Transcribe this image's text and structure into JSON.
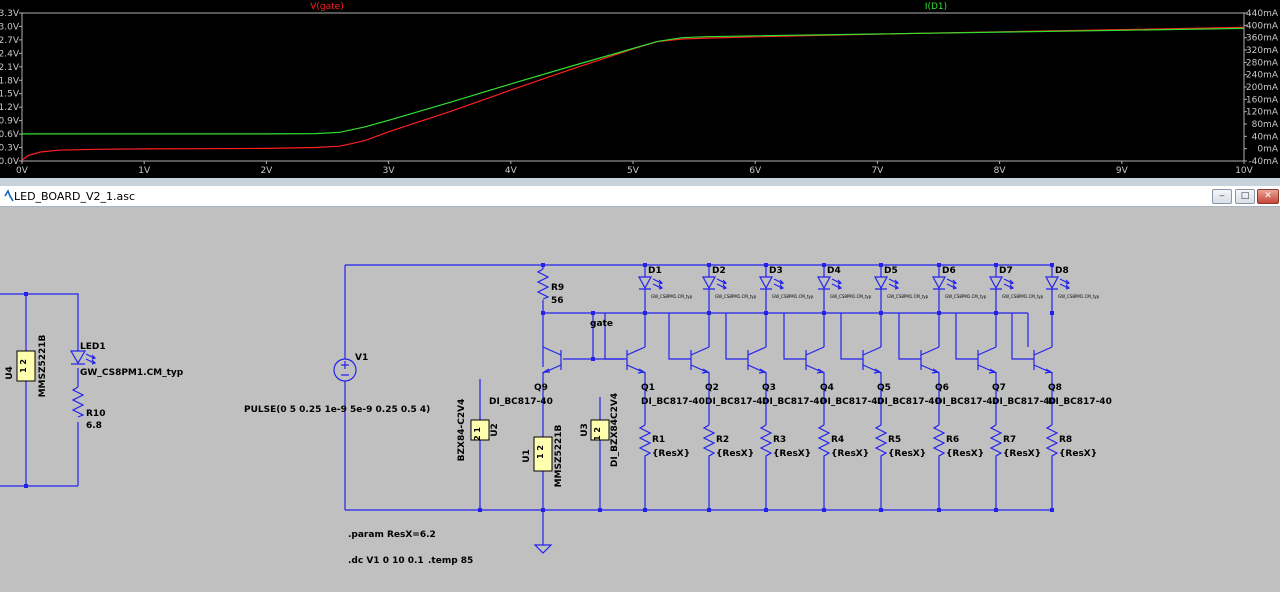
{
  "chart_data": {
    "type": "line",
    "series": [
      {
        "name": "V(gate)",
        "color": "#ff2020",
        "axis": "left",
        "x": [
          0,
          0.05,
          0.15,
          0.3,
          0.6,
          1.0,
          1.5,
          2.0,
          2.4,
          2.6,
          2.8,
          3.0,
          3.5,
          4.0,
          4.5,
          5.0,
          5.2,
          5.4,
          5.6,
          6,
          7,
          8,
          9,
          10
        ],
        "y": [
          0.02,
          0.12,
          0.2,
          0.24,
          0.26,
          0.27,
          0.275,
          0.28,
          0.3,
          0.33,
          0.45,
          0.65,
          1.1,
          1.58,
          2.05,
          2.5,
          2.66,
          2.72,
          2.74,
          2.77,
          2.83,
          2.88,
          2.93,
          2.98
        ]
      },
      {
        "name": "I(D1)",
        "color": "#30e030",
        "axis": "right",
        "x": [
          0,
          1,
          2,
          2.4,
          2.6,
          2.8,
          3.0,
          3.5,
          4.0,
          4.5,
          5.0,
          5.2,
          5.4,
          5.6,
          6,
          7,
          8,
          9,
          10
        ],
        "y": [
          48,
          48,
          48,
          49,
          53,
          70,
          92,
          150,
          210,
          268,
          325,
          348,
          360,
          363,
          366,
          372,
          378,
          384,
          390
        ]
      }
    ],
    "x_ticks": [
      "0V",
      "1V",
      "2V",
      "3V",
      "4V",
      "5V",
      "6V",
      "7V",
      "8V",
      "9V",
      "10V"
    ],
    "y_left_ticks": [
      "0.0V",
      "0.3V",
      "0.6V",
      "0.9V",
      "1.2V",
      "1.5V",
      "1.8V",
      "2.1V",
      "2.4V",
      "2.7V",
      "3.0V",
      "3.3V"
    ],
    "y_right_ticks": [
      "-40mA",
      "0mA",
      "40mA",
      "80mA",
      "120mA",
      "160mA",
      "200mA",
      "240mA",
      "280mA",
      "320mA",
      "360mA",
      "400mA",
      "440mA"
    ],
    "xlim": [
      0,
      10
    ],
    "ylim_left": [
      0,
      3.3
    ],
    "ylim_right": [
      -40,
      440
    ],
    "grid": false,
    "legend": [
      "V(gate)",
      "I(D1)"
    ]
  },
  "window": {
    "title": "LED_BOARD_V2_1.asc",
    "btn_min": "‒",
    "btn_max": "□",
    "btn_close": "✕"
  },
  "schematic": {
    "led1": {
      "name": "LED1",
      "model": "GW_CS8PM1.CM_typ"
    },
    "u4": {
      "name": "U4",
      "model": "MMSZ5221B",
      "pins": "1 2"
    },
    "r10": {
      "name": "R10",
      "value": "6.8"
    },
    "v1": {
      "name": "V1",
      "value": "PULSE(0 5 0.25 1e-9 5e-9 0.25 0.5 4)"
    },
    "r9": {
      "name": "R9",
      "value": "56"
    },
    "gate_label": "gate",
    "q9": {
      "name": "Q9",
      "model": "DI_BC817-40"
    },
    "u2": {
      "name": "U2",
      "model": "BZX84-C2V4",
      "pins": "2 1"
    },
    "u1": {
      "name": "U1",
      "model": "MMSZ5221B",
      "pins": "1 2"
    },
    "u3": {
      "name": "U3",
      "model": "DI_BZX84C2V4",
      "pins": "1 2"
    },
    "led_model_small": "GW_CS8PM1.CM_typ",
    "diodes": [
      "D1",
      "D2",
      "D3",
      "D4",
      "D5",
      "D6",
      "D7",
      "D8"
    ],
    "transistors": [
      "Q1",
      "Q2",
      "Q3",
      "Q4",
      "Q5",
      "Q6",
      "Q7",
      "Q8"
    ],
    "transistor_models": [
      "DI_BC817-40",
      "DI_BC817-40",
      "DI_BC817-40",
      "DI_BC817-40",
      "DI_BC817-40",
      "DI_BC817-40",
      "DI_BC817-40",
      "DI_BC817-40"
    ],
    "resistors": [
      "R1",
      "R2",
      "R3",
      "R4",
      "R5",
      "R6",
      "R7",
      "R8"
    ],
    "resistor_value": "{ResX}",
    "param": ".param ResX=6.2",
    "dc": ".dc V1 0 10 0.1",
    "temp": ".temp 85"
  }
}
